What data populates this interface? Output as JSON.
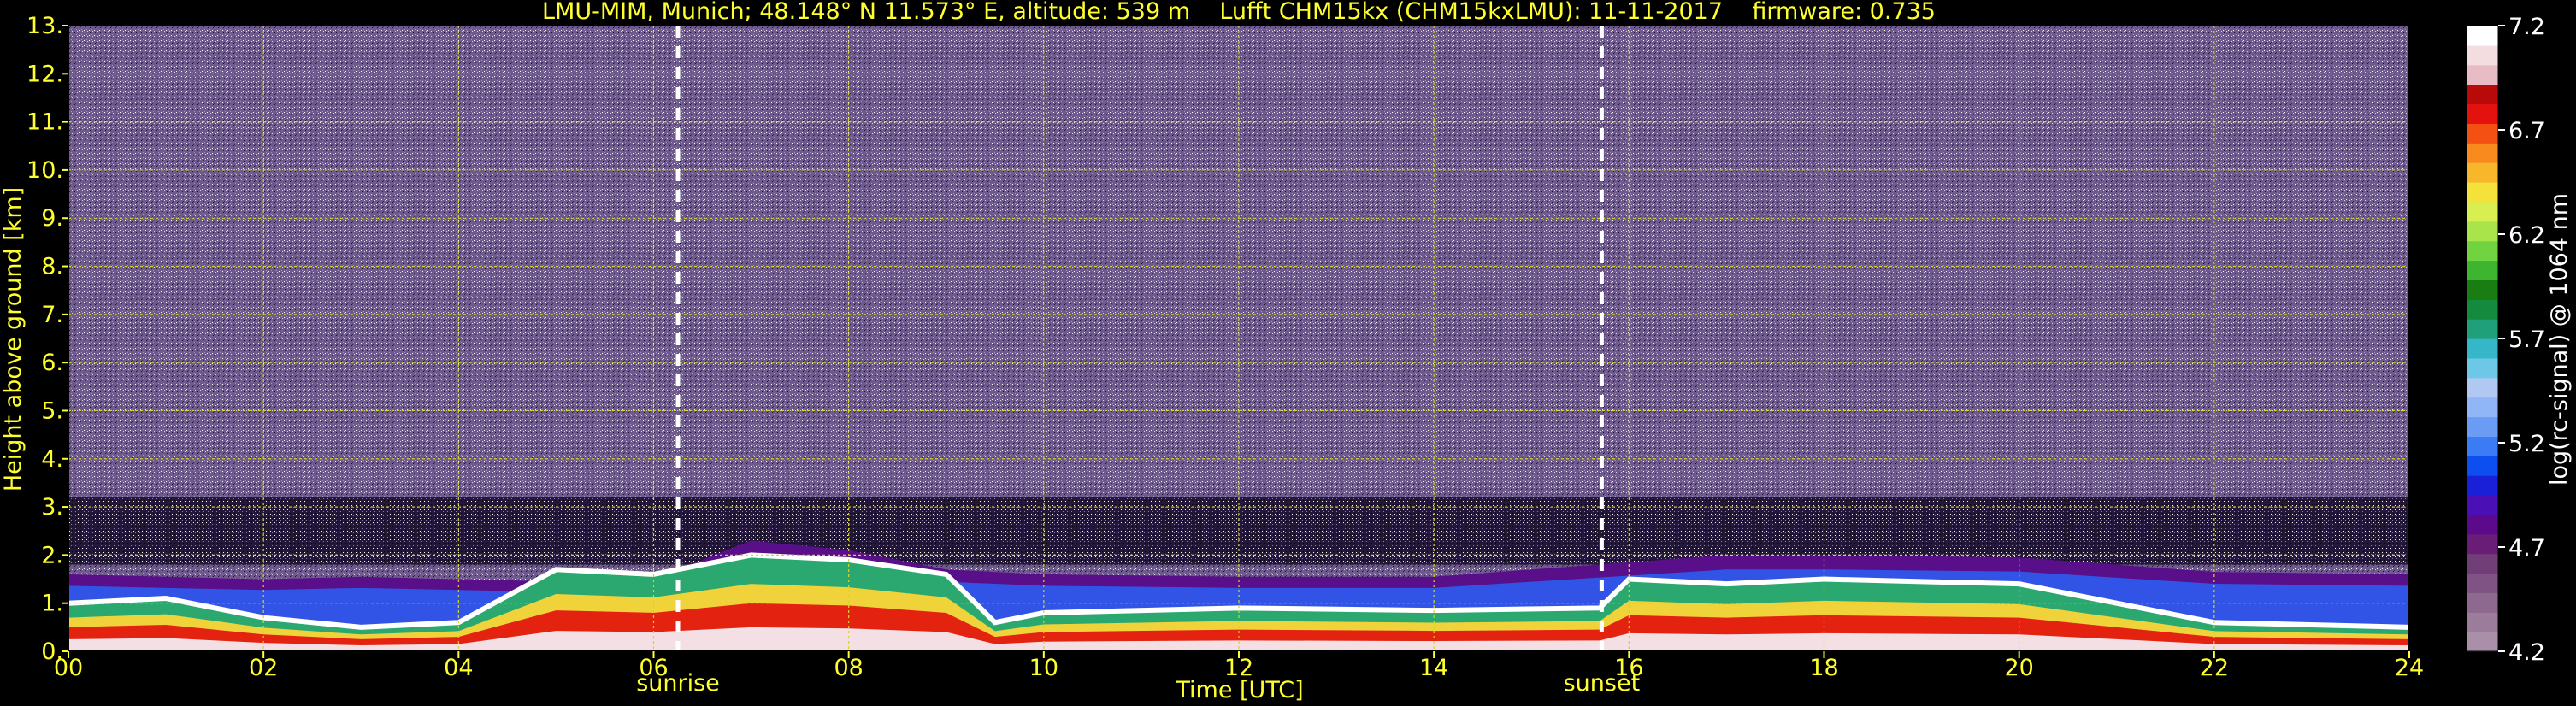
{
  "chart_data": {
    "type": "heatmap",
    "title": "LMU-MIM, Munich; 48.148° N 11.573° E, altitude: 539 m    Lufft CHM15kx (CHM15kxLMU): 11-11-2017    firmware: 0.735",
    "xlabel": "Time [UTC]",
    "ylabel": "Height above ground [km]",
    "xlim": [
      0,
      24
    ],
    "ylim": [
      0,
      13
    ],
    "xticks": [
      "00",
      "02",
      "04",
      "06",
      "08",
      "10",
      "12",
      "14",
      "16",
      "18",
      "20",
      "22",
      "24"
    ],
    "yticks": [
      "0.",
      "1.",
      "2.",
      "3.",
      "4.",
      "5.",
      "6.",
      "7.",
      "8.",
      "9.",
      "10.",
      "11.",
      "12.",
      "13."
    ],
    "grid": true,
    "events": [
      {
        "label": "sunrise",
        "time": 6.25
      },
      {
        "label": "sunset",
        "time": 15.72
      }
    ],
    "colorbar": {
      "label": "log(rc-signal) @ 1064 nm",
      "ticks": [
        "4.2",
        "4.7",
        "5.2",
        "5.7",
        "6.2",
        "6.7",
        "7.2"
      ],
      "range": [
        4.2,
        7.2
      ],
      "colors": [
        "#a98fa8",
        "#9c7c9b",
        "#8d688f",
        "#7f5383",
        "#723e77",
        "#6a1d76",
        "#5c0a8c",
        "#4a10b5",
        "#1a20d8",
        "#0d4ef0",
        "#3b7cf4",
        "#6a9cf6",
        "#90b6f8",
        "#b0c8f2",
        "#6dc8e8",
        "#36b7c9",
        "#1fa07a",
        "#138a3e",
        "#1a7d12",
        "#3db530",
        "#72d340",
        "#a8e44a",
        "#d8ef52",
        "#f4e13a",
        "#f8b62a",
        "#f88a1e",
        "#f55014",
        "#e3120f",
        "#b90a0a",
        "#e8bcc4",
        "#f4dde1",
        "#ffffff"
      ]
    },
    "layers": [
      {
        "name": "noise-background",
        "from": 0,
        "to": 24,
        "base": 0,
        "top": 13
      },
      {
        "name": "boundary-layer",
        "points": [
          [
            0,
            1.6
          ],
          [
            1,
            1.55
          ],
          [
            2,
            1.5
          ],
          [
            3,
            1.55
          ],
          [
            4,
            1.5
          ],
          [
            5,
            1.45
          ],
          [
            6,
            1.5
          ],
          [
            7,
            2.3
          ],
          [
            8,
            2.1
          ],
          [
            9,
            1.7
          ],
          [
            10,
            1.6
          ],
          [
            12,
            1.55
          ],
          [
            14,
            1.55
          ],
          [
            16,
            1.85
          ],
          [
            17,
            2.0
          ],
          [
            18,
            2.0
          ],
          [
            20,
            1.95
          ],
          [
            22,
            1.65
          ],
          [
            24,
            1.6
          ]
        ]
      },
      {
        "name": "aerosol-top",
        "points": [
          [
            0,
            1.0
          ],
          [
            1,
            1.1
          ],
          [
            2,
            0.7
          ],
          [
            3,
            0.5
          ],
          [
            4,
            0.6
          ],
          [
            5,
            1.7
          ],
          [
            6,
            1.6
          ],
          [
            7,
            2.0
          ],
          [
            8,
            1.9
          ],
          [
            9,
            1.6
          ],
          [
            9.5,
            0.6
          ],
          [
            10,
            0.8
          ],
          [
            12,
            0.9
          ],
          [
            14,
            0.85
          ],
          [
            15.7,
            0.9
          ],
          [
            16,
            1.5
          ],
          [
            17,
            1.4
          ],
          [
            18,
            1.5
          ],
          [
            20,
            1.4
          ],
          [
            21,
            1.0
          ],
          [
            22,
            0.6
          ],
          [
            24,
            0.5
          ]
        ]
      }
    ]
  }
}
